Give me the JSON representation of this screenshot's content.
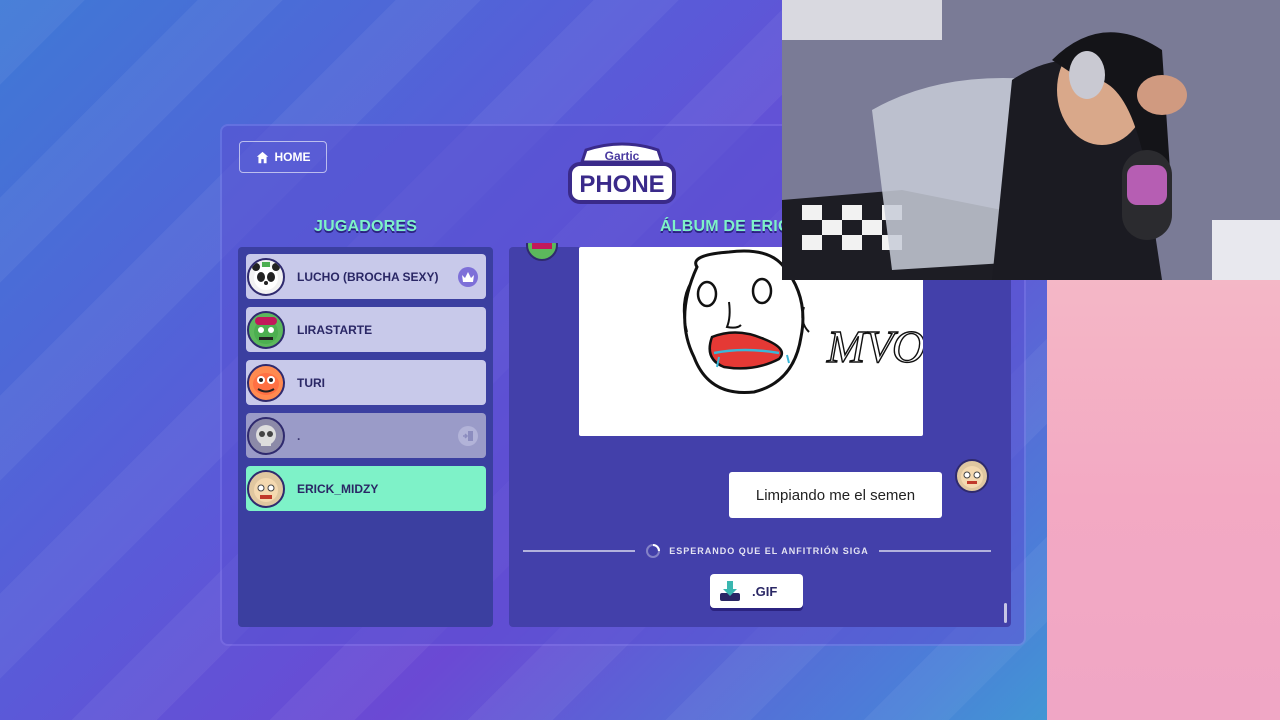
{
  "app": {
    "logo_top": "Gartic",
    "logo_bottom": "PHONE"
  },
  "header": {
    "home_label": "HOME"
  },
  "players": {
    "title": "JUGADORES",
    "items": [
      {
        "name": "LUCHO (BROCHA SEXY)",
        "badge": "crown-icon",
        "state": "normal"
      },
      {
        "name": "LIRASTARTE",
        "badge": "",
        "state": "normal"
      },
      {
        "name": "TURI",
        "badge": "",
        "state": "normal"
      },
      {
        "name": ".",
        "badge": "exit-icon",
        "state": "disconnected"
      },
      {
        "name": "ERICK_MIDZY",
        "badge": "",
        "state": "active"
      }
    ]
  },
  "album": {
    "title": "ÁLBUM DE ERIC",
    "drawing_text": "MVO",
    "message": "Limpiando me el semen",
    "waiting_text": "ESPERANDO QUE EL ANFITRIÓN SIGA",
    "gif_label": ".GIF"
  },
  "colors": {
    "accent_green": "#7ef2c8",
    "active_row": "#7ef2c8",
    "panel": "#3b3fa0"
  }
}
